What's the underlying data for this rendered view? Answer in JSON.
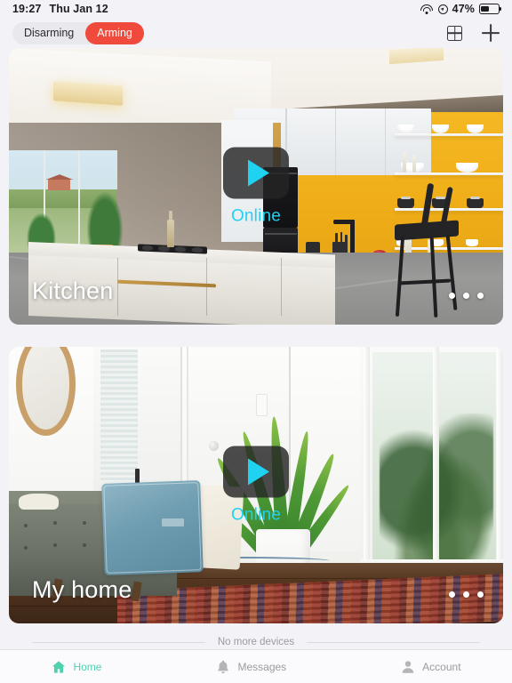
{
  "status_bar": {
    "time": "19:27",
    "date": "Thu Jan 12",
    "wifi_icon": "wifi-icon",
    "location_icon": "location-services-icon",
    "battery_percent": "47%",
    "battery_level": 47,
    "battery_icon": "battery-icon"
  },
  "toolbar": {
    "segment": {
      "options": [
        "Disarming",
        "Arming"
      ],
      "selected": "Arming",
      "selected_color": "#EF4A3C"
    },
    "grid_icon": "grid-view-icon",
    "add_icon": "plus-icon"
  },
  "devices": [
    {
      "title": "Kitchen",
      "status": "Online",
      "status_color": "#1FD2F2",
      "play_icon": "play-icon",
      "more_icon": "more-dots-icon",
      "scene": "kitchen"
    },
    {
      "title": "My home",
      "status": "Online",
      "status_color": "#1FD2F2",
      "play_icon": "play-icon",
      "more_icon": "more-dots-icon",
      "scene": "living-room"
    }
  ],
  "list_footer": {
    "text": "No more devices"
  },
  "tab_bar": {
    "active": "Home",
    "active_color": "#4FD1B0",
    "inactive_color": "#9B9BA0",
    "items": [
      {
        "label": "Home",
        "icon": "home-icon"
      },
      {
        "label": "Messages",
        "icon": "bell-icon"
      },
      {
        "label": "Account",
        "icon": "person-icon"
      }
    ]
  }
}
